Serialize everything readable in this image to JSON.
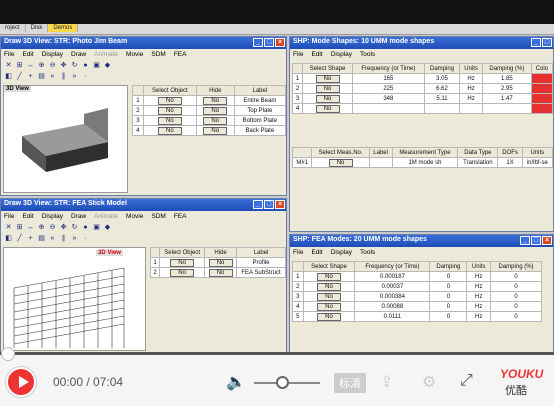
{
  "tabs": [
    "roject",
    "Disk",
    "Demos"
  ],
  "win1": {
    "title": "Draw 3D View: STR: Photo Jim Beam",
    "menu": [
      "File",
      "Edit",
      "Display",
      "Draw",
      "Animate",
      "Movie",
      "SDM",
      "FEA"
    ],
    "view_label": "3D View",
    "headers": [
      "Select Object",
      "Hide",
      "Label"
    ],
    "rows": [
      {
        "n": "1",
        "sel": "No",
        "hide": "No",
        "label": "Entire Beam"
      },
      {
        "n": "2",
        "sel": "No",
        "hide": "No",
        "label": "Top Plate"
      },
      {
        "n": "3",
        "sel": "No",
        "hide": "No",
        "label": "Bottom Plate"
      },
      {
        "n": "4",
        "sel": "No",
        "hide": "No",
        "label": "Back Plate"
      }
    ]
  },
  "win2": {
    "title": "SHP: Mode Shapes: 10 UMM mode shapes",
    "menu": [
      "File",
      "Edit",
      "Display",
      "Tools"
    ],
    "headers": [
      "Select Shape",
      "Frequency (or Time)",
      "Damping",
      "Units",
      "Damping (%)",
      "Colo"
    ],
    "rows": [
      {
        "n": "1",
        "sel": "No",
        "freq": "165",
        "damp": "3.05",
        "units": "Hz",
        "pct": "1.85"
      },
      {
        "n": "2",
        "sel": "No",
        "freq": "225",
        "damp": "6.62",
        "units": "Hz",
        "pct": "2.95"
      },
      {
        "n": "3",
        "sel": "No",
        "freq": "348",
        "units": "Hz",
        "damp": "5.11",
        "pct": "1.47"
      },
      {
        "n": "4",
        "sel": "No",
        "freq": "",
        "damp": "",
        "units": "",
        "pct": ""
      }
    ],
    "sub_headers": [
      "Select Meas.No.",
      "Label",
      "Measurement Type",
      "Data Type",
      "DOFs",
      "Units"
    ],
    "sub_row": {
      "id": "M#1",
      "sel": "No",
      "label": "",
      "type": "1M mode sh",
      "dtype": "Translation",
      "dofs": "1X",
      "units": "in/lbf-se"
    }
  },
  "win3": {
    "title": "Draw 3D View: STR: FEA Stick Model",
    "menu": [
      "File",
      "Edit",
      "Display",
      "Draw",
      "Animate",
      "Movie",
      "SDM",
      "FEA"
    ],
    "view_label": "3D View",
    "headers": [
      "Select Object",
      "Hide",
      "Label"
    ],
    "rows": [
      {
        "n": "1",
        "sel": "No",
        "hide": "No",
        "label": "Profile"
      },
      {
        "n": "2",
        "sel": "No",
        "hide": "No",
        "label": "FEA SubStruct"
      }
    ]
  },
  "win4": {
    "title": "SHP: FEA Modes: 20 UMM mode shapes",
    "menu": [
      "File",
      "Edit",
      "Display",
      "Tools"
    ],
    "headers": [
      "Select Shape",
      "Frequency (or Time)",
      "Damping",
      "Units",
      "Damping (%)"
    ],
    "rows": [
      {
        "n": "1",
        "sel": "No",
        "freq": "0.000187",
        "damp": "0",
        "units": "Hz",
        "pct": "0"
      },
      {
        "n": "2",
        "sel": "No",
        "freq": "0.00037",
        "damp": "0",
        "units": "Hz",
        "pct": "0"
      },
      {
        "n": "3",
        "sel": "No",
        "freq": "0.000384",
        "damp": "0",
        "units": "Hz",
        "pct": "0"
      },
      {
        "n": "4",
        "sel": "No",
        "freq": "0.00088",
        "damp": "0",
        "units": "Hz",
        "pct": "0"
      },
      {
        "n": "5",
        "sel": "No",
        "freq": "0.0111",
        "damp": "0",
        "units": "Hz",
        "pct": "0"
      }
    ]
  },
  "player": {
    "time": "00:00 / 07:04",
    "quality": "标清",
    "brand": "YOUKU",
    "brand_cn": "优酷",
    "progress": 0.0,
    "volume": 0.35
  }
}
